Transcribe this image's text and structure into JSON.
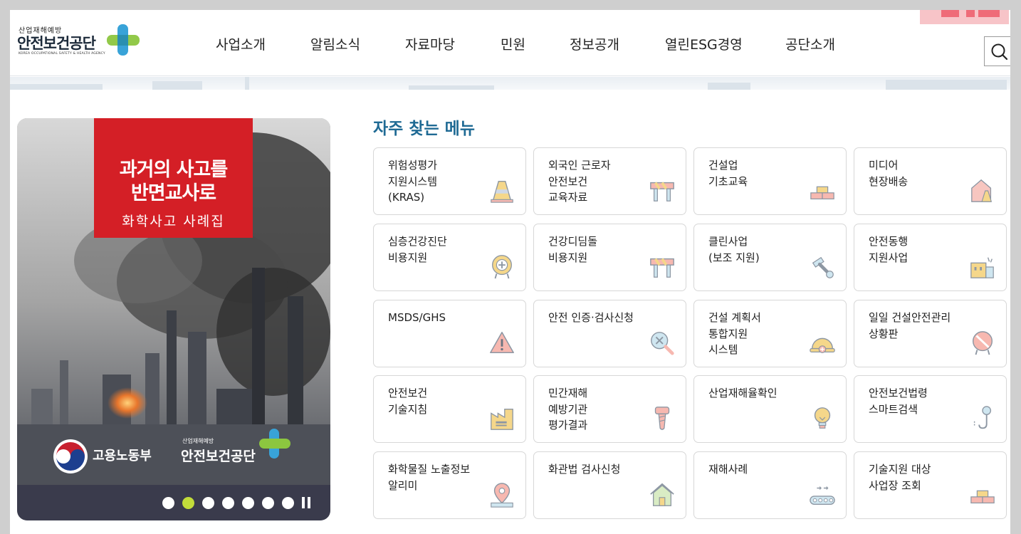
{
  "logo": {
    "sub": "산업재해예방",
    "main": "안전보건공단",
    "eng": "KOREA OCCUPATIONAL SAFETY & HEALTH AGENCY"
  },
  "nav": [
    "사업소개",
    "알림소식",
    "자료마당",
    "민원",
    "정보공개",
    "열린ESG경영",
    "공단소개"
  ],
  "banner": {
    "headline_1": "과거의 사고를",
    "headline_2": "반면교사로",
    "subline": "화학사고 사례집",
    "ministry": "고용노동부",
    "agency_sub": "산업재해예방",
    "agency": "안전보건공단",
    "slide_count": 7,
    "active_slide": 2
  },
  "quick_menu": {
    "title": "자주 찾는 메뉴",
    "items": [
      {
        "label": "위험성평가\n지원시스템\n(KRAS)",
        "icon": "traffic-cone-icon"
      },
      {
        "label": "외국인 근로자\n안전보건\n교육자료",
        "icon": "barrier-icon"
      },
      {
        "label": "건설업\n기초교육",
        "icon": "bricks-icon"
      },
      {
        "label": "미디어\n현장배송",
        "icon": "house-cone-icon"
      },
      {
        "label": "심층건강진단\n비용지원",
        "icon": "medical-badge-icon"
      },
      {
        "label": "건강디딤돌\n비용지원",
        "icon": "barrier-icon"
      },
      {
        "label": "클린사업\n(보조 지원)",
        "icon": "screws-icon"
      },
      {
        "label": "안전동행\n지원사업",
        "icon": "building-icon"
      },
      {
        "label": "MSDS/GHS",
        "icon": "warning-icon"
      },
      {
        "label": "안전 인증·검사신청",
        "icon": "magnifier-tools-icon"
      },
      {
        "label": "건설 계획서\n통합지원\n시스템",
        "icon": "helmet-icon"
      },
      {
        "label": "일일 건설안전관리\n상황판",
        "icon": "no-entry-sign-icon"
      },
      {
        "label": "안전보건\n기술지침",
        "icon": "factory-icon"
      },
      {
        "label": "민간재해\n예방기관\n평가결과",
        "icon": "bolt-icon"
      },
      {
        "label": "산업재해율확인",
        "icon": "lightbulb-icon"
      },
      {
        "label": "안전보건법령\n스마트검색",
        "icon": "crane-hook-icon"
      },
      {
        "label": "화학물질 노출정보\n알리미",
        "icon": "map-pin-icon"
      },
      {
        "label": "화관법 검사신청",
        "icon": "home-icon"
      },
      {
        "label": "재해사례",
        "icon": "conveyor-icon"
      },
      {
        "label": "기술지원 대상\n사업장 조회",
        "icon": "bricks-icon"
      }
    ]
  },
  "colors": {
    "title_blue": "#1f6a94",
    "active_dot": "#c2dc3a",
    "banner_red": "#d41f26",
    "control_bar": "#3a3b4c"
  }
}
